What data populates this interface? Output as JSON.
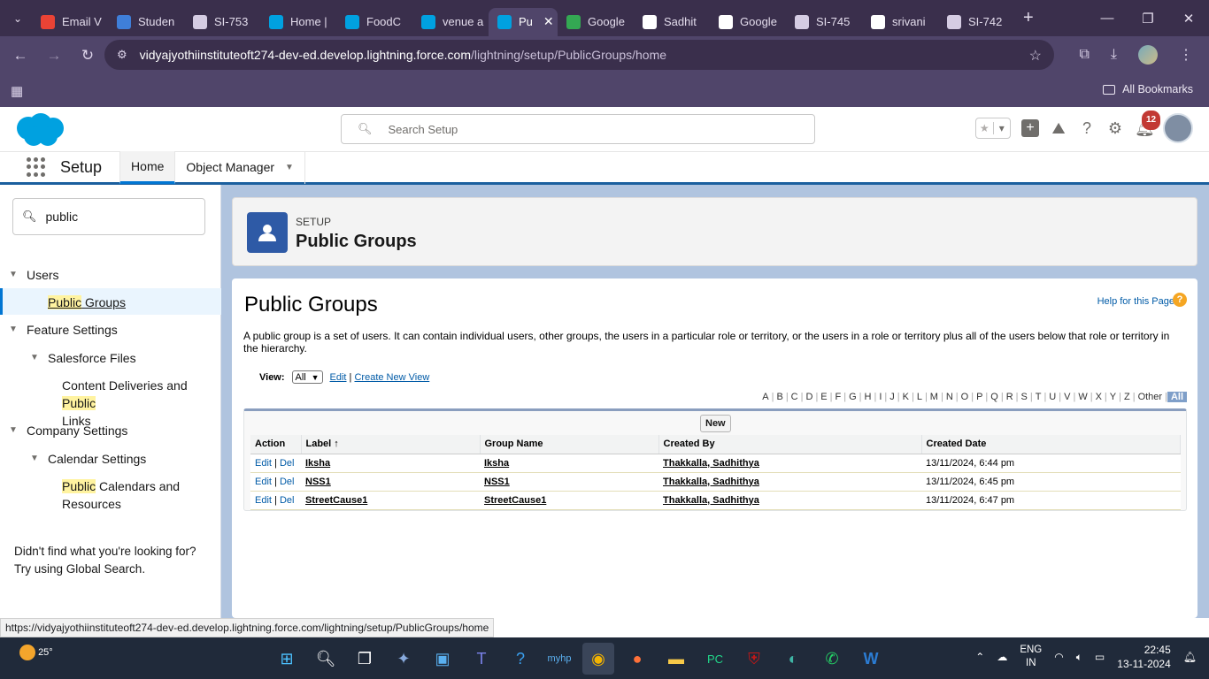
{
  "browser": {
    "tabs": [
      {
        "label": "Email V",
        "color": "#ea4335"
      },
      {
        "label": "Studen",
        "color": "#3f7fd9"
      },
      {
        "label": "SI-753",
        "color": "#d5cce3"
      },
      {
        "label": "Home |",
        "color": "#00a1e0"
      },
      {
        "label": "FoodC",
        "color": "#00a1e0"
      },
      {
        "label": "venue a",
        "color": "#00a1e0"
      },
      {
        "label": "Pu",
        "color": "#00a1e0",
        "active": true
      },
      {
        "label": "Google",
        "color": "#34a853"
      },
      {
        "label": "Sadhit",
        "color": "#ffffff"
      },
      {
        "label": "Google",
        "color": "#ffffff"
      },
      {
        "label": "SI-745",
        "color": "#d5cce3"
      },
      {
        "label": "srivani",
        "color": "#ffffff"
      },
      {
        "label": "SI-742",
        "color": "#d5cce3"
      }
    ],
    "url_host": "vidyajyothiinstituteoft274-dev-ed.develop.lightning.force.com",
    "url_path": "/lightning/setup/PublicGroups/home",
    "bookmarks_label": "All Bookmarks",
    "status_url": "https://vidyajyothiinstituteoft274-dev-ed.develop.lightning.force.com/lightning/setup/PublicGroups/home"
  },
  "sf": {
    "search_placeholder": "Search Setup",
    "notif_count": "12",
    "app_name": "Setup",
    "nav": {
      "home": "Home",
      "object_manager": "Object Manager"
    }
  },
  "sidebar": {
    "quickfind_value": "public",
    "users": "Users",
    "public_groups_hl": "Public",
    "public_groups_rest": " Groups",
    "feature_settings": "Feature Settings",
    "salesforce_files": "Salesforce Files",
    "content_deliveries_a": "Content Deliveries and ",
    "content_deliveries_hl": "Public",
    "content_deliveries_b": "Links",
    "company_settings": "Company Settings",
    "calendar_settings": "Calendar Settings",
    "public_calendars_hl": "Public",
    "public_calendars_a": " Calendars and",
    "public_calendars_b": "Resources",
    "not_found_1": "Didn't find what you're looking for?",
    "not_found_2": "Try using Global Search."
  },
  "page": {
    "setup_label": "SETUP",
    "header_title": "Public Groups",
    "title": "Public Groups",
    "help_link": "Help for this Page",
    "description": "A public group is a set of users. It can contain individual users, other groups, the users in a particular role or territory, or the users in a role or territory plus all of the users below that role or territory in the hierarchy.",
    "view_label": "View:",
    "view_value": "All",
    "edit_link": "Edit",
    "create_view_link": "Create New View",
    "alphabet": [
      "A",
      "B",
      "C",
      "D",
      "E",
      "F",
      "G",
      "H",
      "I",
      "J",
      "K",
      "L",
      "M",
      "N",
      "O",
      "P",
      "Q",
      "R",
      "S",
      "T",
      "U",
      "V",
      "W",
      "X",
      "Y",
      "Z",
      "Other",
      "All"
    ],
    "new_button": "New",
    "columns": {
      "action": "Action",
      "label": "Label",
      "group_name": "Group Name",
      "created_by": "Created By",
      "created_date": "Created Date"
    },
    "rows": [
      {
        "label": "Iksha",
        "group_name": "Iksha",
        "created_by": "Thakkalla, Sadhithya",
        "created_date": "13/11/2024, 6:44 pm"
      },
      {
        "label": "NSS1",
        "group_name": "NSS1",
        "created_by": "Thakkalla, Sadhithya",
        "created_date": "13/11/2024, 6:45 pm"
      },
      {
        "label": "StreetCause1",
        "group_name": "StreetCause1",
        "created_by": "Thakkalla, Sadhithya",
        "created_date": "13/11/2024, 6:47 pm"
      }
    ],
    "edit_action": "Edit",
    "del_action": "Del"
  },
  "taskbar": {
    "temperature": "25°",
    "lang_1": "ENG",
    "lang_2": "IN",
    "time": "22:45",
    "date": "13-11-2024"
  }
}
